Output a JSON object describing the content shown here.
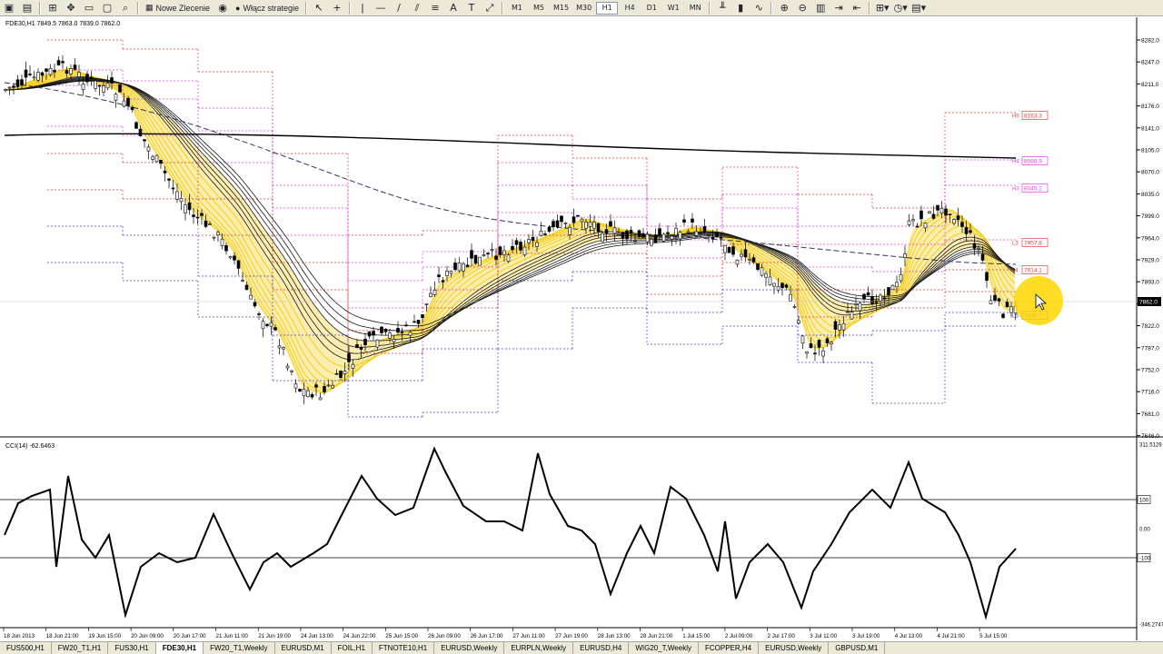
{
  "toolbar": {
    "new_order_label": "Nowe Zlecenie",
    "strategies_label": "Włącz strategie",
    "timeframes": [
      "M1",
      "M5",
      "M15",
      "M30",
      "H1",
      "H4",
      "D1",
      "W1",
      "MN"
    ],
    "active_timeframe": "H1"
  },
  "main_chart": {
    "header": "FDE30,H1  7849.5 7863.0 7839.0 7862.0",
    "price_ticks": [
      "8282.0",
      "8247.0",
      "8211.0",
      "8176.0",
      "8141.0",
      "8105.0",
      "8070.0",
      "8035.0",
      "7999.0",
      "7964.0",
      "7929.0",
      "7893.0",
      "7858.0",
      "7822.0",
      "7787.0",
      "7752.0",
      "7716.0",
      "7681.0",
      "7646.0"
    ],
    "current_price": "7862.0",
    "pivot_labels": [
      {
        "level": "H5",
        "value": "8163.3",
        "color": "#e04040"
      },
      {
        "level": "H4",
        "value": "8088.9",
        "color": "#e040e0"
      },
      {
        "level": "H3",
        "value": "8045.2",
        "color": "#e040e0"
      },
      {
        "level": "L3",
        "value": "7957.8",
        "color": "#e04040"
      },
      {
        "level": "L4",
        "value": "7914.1",
        "color": "#e04040"
      },
      {
        "level": "L5",
        "value": "7839.7",
        "color": "#4040e0"
      }
    ]
  },
  "cci_panel": {
    "header": "CCI(14) -62.6463",
    "ticks": [
      "311.5129",
      "100",
      "0.00",
      "-100",
      "-346.2747"
    ]
  },
  "time_axis": [
    "18 Jun 2013",
    "18 Jun 21:00",
    "19 Jun 15:00",
    "20 Jun 09:00",
    "20 Jun 17:00",
    "21 Jun 11:00",
    "21 Jun 19:00",
    "24 Jun 13:00",
    "24 Jun 22:00",
    "25 Jun 15:00",
    "26 Jun 09:00",
    "26 Jun 17:00",
    "27 Jun 11:00",
    "27 Jun 19:00",
    "28 Jun 13:00",
    "28 Jun 21:00",
    "1 Jul 15:00",
    "2 Jul 09:00",
    "2 Jul 17:00",
    "3 Jul 11:00",
    "3 Jul 19:00",
    "4 Jul 13:00",
    "4 Jul 21:00",
    "5 Jul 15:00"
  ],
  "tabs": [
    "FUS500,H1",
    "FW20_T1,H1",
    "FUS30,H1",
    "FDE30,H1",
    "FW20_T1,Weekly",
    "EURUSD,M1",
    "FOIL,H1",
    "FTNOTE10,H1",
    "EURUSD,Weekly",
    "EURPLN,Weekly",
    "EURUSD,H4",
    "WIG20_T,Weekly",
    "FCOPPER,H4",
    "EURUSD,Weekly",
    "GBPUSD,M1"
  ],
  "active_tab": "FDE30,H1",
  "colors": {
    "fan": "#f4cf1c",
    "cursor_highlight": "#ffd700",
    "pivot_red": "#e04040",
    "pivot_magenta": "#e040e0",
    "pivot_blue": "#4040e0"
  }
}
